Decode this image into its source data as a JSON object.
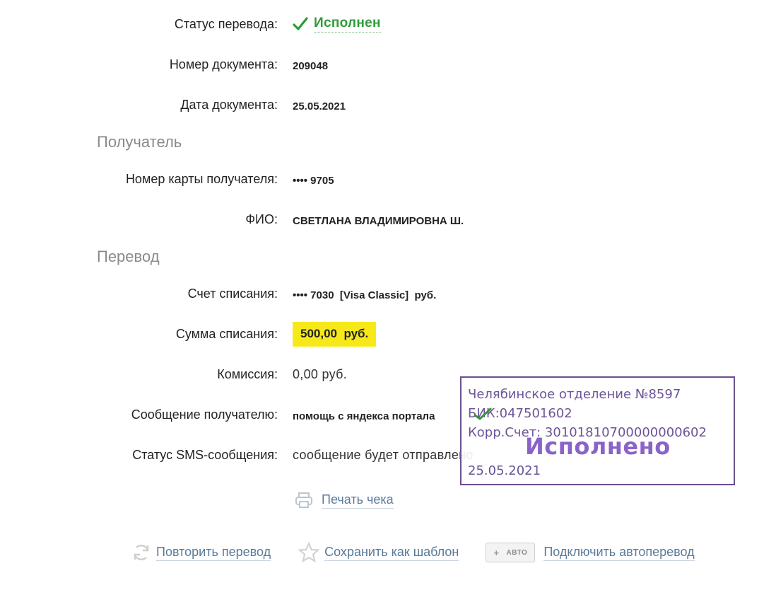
{
  "status": {
    "label": "Статус перевода:",
    "value": "Исполнен",
    "color": "#2e9b37",
    "icon": "checkmark-icon"
  },
  "document": {
    "number_label": "Номер документа:",
    "number": "209048",
    "date_label": "Дата документа:",
    "date": "25.05.2021"
  },
  "recipient": {
    "section_title": "Получатель",
    "card_label": "Номер карты получателя:",
    "card": "•••• 9705",
    "name_label": "ФИО:",
    "name": "СВЕТЛАНА ВЛАДИМИРОВНА Ш."
  },
  "transfer": {
    "section_title": "Перевод",
    "account_label": "Счет списания:",
    "account": "•••• 7030  [Visa Classic]  руб.",
    "amount_label": "Сумма списания:",
    "amount": "500,00  руб.",
    "amount_highlight": "#f7e81a",
    "fee_label": "Комиссия:",
    "fee": "0,00 руб.",
    "message_label": "Сообщение получателю:",
    "message": "помощь с яндекса портала",
    "sms_label": "Статус SMS-сообщения:",
    "sms": "сообщение будет отправлено"
  },
  "print": {
    "label": "Печать чека",
    "icon": "printer-icon"
  },
  "actions": {
    "repeat": {
      "label": "Повторить перевод",
      "icon": "refresh-icon"
    },
    "template": {
      "label": "Сохранить как шаблон",
      "icon": "star-icon"
    },
    "auto": {
      "badge": "АВТО",
      "badge_plus": "+",
      "label": "Подключить автоперевод"
    }
  },
  "stamp": {
    "bank": "Челябинское отделение №8597",
    "bik": "БИК:047501602",
    "corr": "Корр.Счет: 30101810700000000602",
    "done": "Исполнено",
    "date": "25.05.2021",
    "border_color": "#6b4f8f",
    "text_color": "#6c5498"
  }
}
